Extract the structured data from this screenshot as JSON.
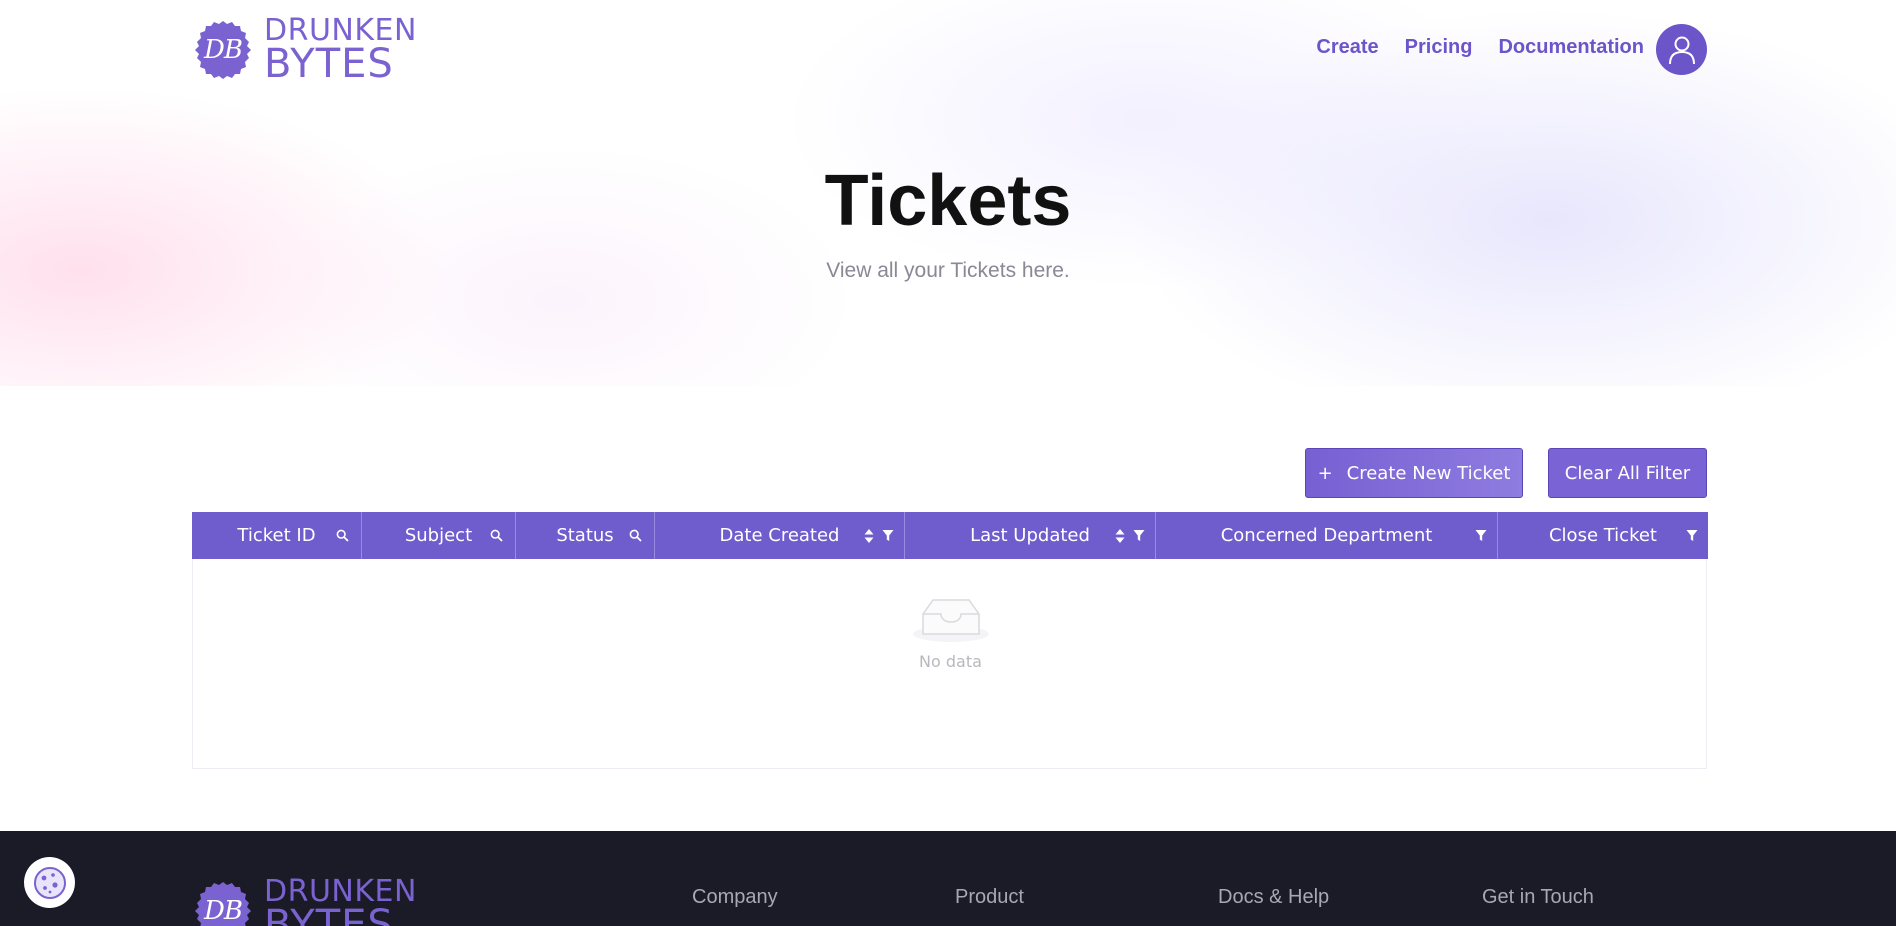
{
  "brand": {
    "badge_text": "DB",
    "word_top": "DRUNKEN",
    "word_bottom": "BYTES",
    "color": "#7a62d0"
  },
  "nav": {
    "items": [
      {
        "label": "Create"
      },
      {
        "label": "Pricing"
      },
      {
        "label": "Documentation"
      }
    ],
    "avatar_icon": "user-icon"
  },
  "hero": {
    "title": "Tickets",
    "subtitle": "View all your Tickets here."
  },
  "actions": {
    "create_plus": "+",
    "create_label": "Create New Ticket",
    "clear_label": "Clear All Filter",
    "accent": "#6f5ccd"
  },
  "table": {
    "columns": [
      {
        "label": "Ticket ID",
        "tools": [
          "search-icon"
        ]
      },
      {
        "label": "Subject",
        "tools": [
          "search-icon"
        ]
      },
      {
        "label": "Status",
        "tools": [
          "search-icon"
        ]
      },
      {
        "label": "Date Created",
        "tools": [
          "sort-icon",
          "filter-icon"
        ]
      },
      {
        "label": "Last Updated",
        "tools": [
          "sort-icon",
          "filter-icon"
        ]
      },
      {
        "label": "Concerned Department",
        "tools": [
          "filter-icon"
        ]
      },
      {
        "label": "Close Ticket",
        "tools": [
          "filter-icon"
        ]
      }
    ],
    "empty_text": "No data",
    "empty_icon": "inbox-icon"
  },
  "footer": {
    "columns": [
      {
        "title": "Company"
      },
      {
        "title": "Product"
      },
      {
        "title": "Docs & Help"
      },
      {
        "title": "Get in Touch"
      }
    ],
    "background": "#1b1b27"
  },
  "cookie": {
    "icon": "cookie-icon"
  }
}
